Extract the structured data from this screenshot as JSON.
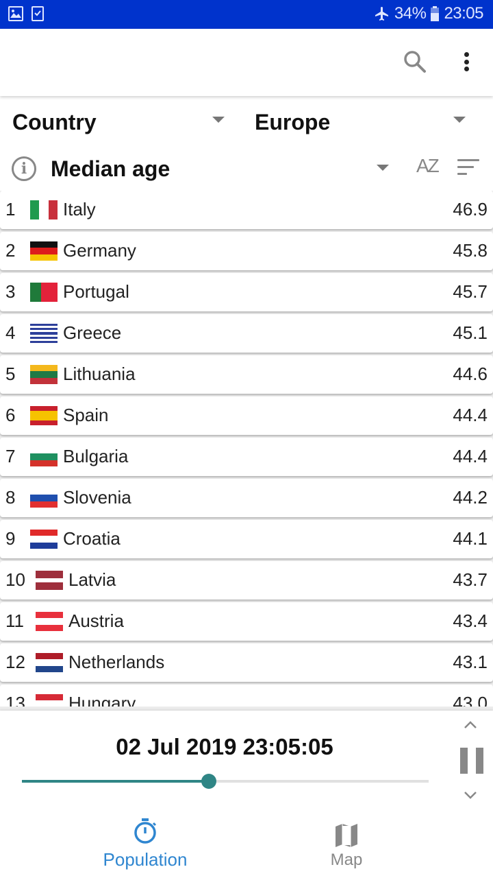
{
  "status_bar": {
    "left_icons": [
      "gallery-icon",
      "task-check-icon"
    ],
    "airplane_icon": "airplane-icon",
    "battery_percent": "34%",
    "battery_icon": "battery-icon",
    "time": "23:05"
  },
  "app_bar": {
    "actions": [
      "search-icon",
      "more-vert-icon"
    ]
  },
  "filters": {
    "entity_dropdown": "Country",
    "region_dropdown": "Europe",
    "metric_dropdown": "Median age",
    "info_icon": "info-icon",
    "sort_alpha_icon": "sort-alpha-icon",
    "sort_alpha_label": "AZ",
    "sort_value_icon": "sort-icon"
  },
  "rows": [
    {
      "rank": "1",
      "name": "Italy",
      "value": "46.9",
      "flag": "it"
    },
    {
      "rank": "2",
      "name": "Germany",
      "value": "45.8",
      "flag": "de"
    },
    {
      "rank": "3",
      "name": "Portugal",
      "value": "45.7",
      "flag": "pt"
    },
    {
      "rank": "4",
      "name": "Greece",
      "value": "45.1",
      "flag": "gr"
    },
    {
      "rank": "5",
      "name": "Lithuania",
      "value": "44.6",
      "flag": "lt"
    },
    {
      "rank": "6",
      "name": "Spain",
      "value": "44.4",
      "flag": "es"
    },
    {
      "rank": "7",
      "name": "Bulgaria",
      "value": "44.4",
      "flag": "bg"
    },
    {
      "rank": "8",
      "name": "Slovenia",
      "value": "44.2",
      "flag": "si"
    },
    {
      "rank": "9",
      "name": "Croatia",
      "value": "44.1",
      "flag": "hr"
    },
    {
      "rank": "10",
      "name": "Latvia",
      "value": "43.7",
      "flag": "lv"
    },
    {
      "rank": "11",
      "name": "Austria",
      "value": "43.4",
      "flag": "at"
    },
    {
      "rank": "12",
      "name": "Netherlands",
      "value": "43.1",
      "flag": "nl"
    },
    {
      "rank": "13",
      "name": "Hungary",
      "value": "43.0",
      "flag": "hu"
    }
  ],
  "player": {
    "datetime": "02 Jul 2019 23:05:05",
    "progress_fraction": 0.46,
    "accent_color": "#2f8585",
    "up_icon": "chevron-up-icon",
    "pause_icon": "pause-icon",
    "down_icon": "chevron-down-icon"
  },
  "bottom_nav": {
    "tabs": [
      {
        "label": "Population",
        "icon": "stopwatch-icon",
        "active": true,
        "color": "#2f86d0"
      },
      {
        "label": "Map",
        "icon": "map-icon",
        "active": false,
        "color": "#888888"
      }
    ]
  }
}
